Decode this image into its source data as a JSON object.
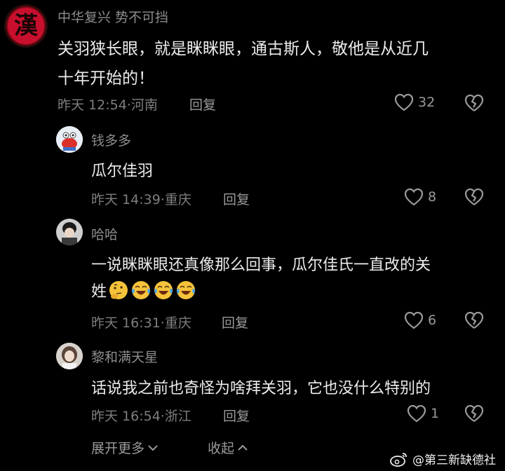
{
  "comments": [
    {
      "user": "中华复兴 势不可挡",
      "avatar_glyph": "漢",
      "avatar_icon": "han-character-seal-icon",
      "lines": [
        "关羽狭长眼，就是眯眯眼，通古斯人，敬他是从近几",
        "十年开始的！"
      ],
      "meta": "昨天 12:54·河南",
      "reply": "回复",
      "likes": "32"
    },
    {
      "user": "钱多多",
      "avatar_icon": "crab-cartoon-avatar-icon",
      "lines": [
        "瓜尔佳羽"
      ],
      "meta": "昨天 14:39·重庆",
      "reply": "回复",
      "likes": "8"
    },
    {
      "user": "哈哈",
      "avatar_icon": "person-photo-avatar-icon",
      "lines": [
        "一说眯眯眼还真像那么回事，瓜尔佳氏一直改的关",
        "姓"
      ],
      "emojis": [
        "thinking-face-emoji",
        "laughing-crying-emoji",
        "laughing-crying-emoji",
        "laughing-crying-emoji"
      ],
      "meta": "昨天 16:31·重庆",
      "reply": "回复",
      "likes": "6"
    },
    {
      "user": "黎和满天星",
      "avatar_icon": "girl-photo-avatar-icon",
      "lines": [
        "话说我之前也奇怪为啥拜关羽，它也没什么特别的"
      ],
      "meta": "昨天 16:54·浙江",
      "reply": "回复",
      "likes": "1"
    }
  ],
  "footer": {
    "expand": "展开更多",
    "collapse": "收起"
  },
  "watermark": {
    "text": "@第三新缺德社",
    "icon": "weibo-logo-icon"
  },
  "colors": {
    "background": "#000000",
    "text": "#ececec",
    "muted": "#8d8d8d",
    "avatar_red": "#c8102e"
  }
}
